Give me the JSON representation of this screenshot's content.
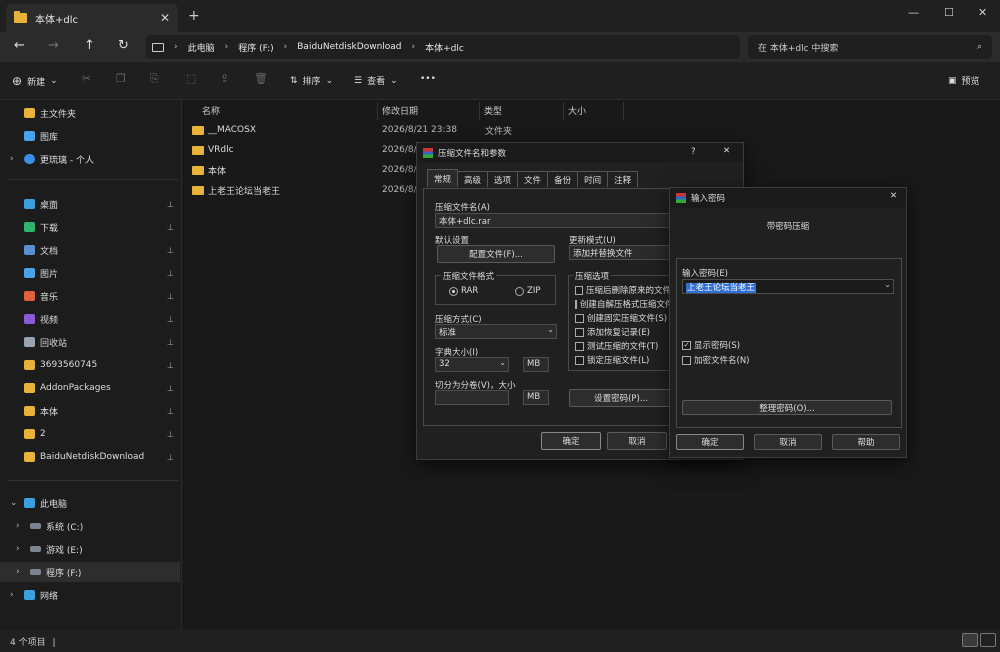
{
  "window": {
    "tab_title": "本体+dlc",
    "tab_close": "✕",
    "tab_add": "+",
    "minimize": "—",
    "maximize": "☐",
    "close": "✕"
  },
  "address": {
    "back": "←",
    "forward": "→",
    "up": "↑",
    "refresh": "↻",
    "crumbs": [
      "此电脑",
      "程序 (F:)",
      "BaiduNetdiskDownload",
      "本体+dlc"
    ],
    "crumb_sep": "›",
    "search_placeholder": "在 本体+dlc 中搜索",
    "search_icon": "⌕"
  },
  "toolbar": {
    "new_label": "新建",
    "sort_label": "排序",
    "view_label": "查看",
    "more_label": "•••",
    "preview_label": "预览",
    "icons": [
      "✂",
      "❐",
      "⎘",
      "⬚",
      "⇪",
      "🗑"
    ]
  },
  "sidebar": {
    "top": [
      {
        "label": "主文件夹",
        "color": "#e8b33b"
      },
      {
        "label": "图库",
        "color": "#4aa3e8"
      },
      {
        "label": "更琉璃 - 个人",
        "color": "#3a8ee6"
      }
    ],
    "pinned": [
      {
        "label": "桌面",
        "color": "#3aa0e0"
      },
      {
        "label": "下载",
        "color": "#2fb56e"
      },
      {
        "label": "文档",
        "color": "#5a8fd0"
      },
      {
        "label": "图片",
        "color": "#4aa3e8"
      },
      {
        "label": "音乐",
        "color": "#e06040"
      },
      {
        "label": "视频",
        "color": "#8a5ad8"
      },
      {
        "label": "回收站",
        "color": "#9aa4b0"
      },
      {
        "label": "3693560745",
        "color": "#e8b33b"
      },
      {
        "label": "AddonPackages",
        "color": "#e8b33b"
      },
      {
        "label": "本体",
        "color": "#e8b33b"
      },
      {
        "label": "2",
        "color": "#e8b33b"
      },
      {
        "label": "BaiduNetdiskDownload",
        "color": "#e8b33b"
      }
    ],
    "pin_icon": "📌",
    "pc_label": "此电脑",
    "drives": [
      {
        "label": "系统 (C:)"
      },
      {
        "label": "游戏 (E:)"
      },
      {
        "label": "程序 (F:)"
      }
    ],
    "network_label": "网络"
  },
  "files": {
    "columns": [
      "名称",
      "修改日期",
      "类型",
      "大小"
    ],
    "rows": [
      {
        "name": "__MACOSX",
        "date": "2026/8/21 23:38",
        "type": "文件夹"
      },
      {
        "name": "VRdlc",
        "date": "2026/8/2"
      },
      {
        "name": "本体",
        "date": "2026/8/2"
      },
      {
        "name": "上老王论坛当老王",
        "date": "2026/8/2"
      }
    ]
  },
  "status": {
    "count": "4 个项目",
    "bar": "|"
  },
  "archive_dialog": {
    "title": "压缩文件名和参数",
    "help": "?",
    "close": "✕",
    "tabs": [
      "常规",
      "高级",
      "选项",
      "文件",
      "备份",
      "时间",
      "注释"
    ],
    "filename_label": "压缩文件名(A)",
    "filename_value": "本体+dlc.rar",
    "default_label": "默认设置",
    "config_btn": "配置文件(F)...",
    "update_label": "更新模式(U)",
    "update_value": "添加并替换文件",
    "format_label": "压缩文件格式",
    "rar_label": "RAR",
    "zip_label": "ZIP",
    "method_label": "压缩方式(C)",
    "method_value": "标准",
    "dict_label": "字典大小(I)",
    "dict_value": "32",
    "dict_unit": "MB",
    "split_label": "切分为分卷(V)，大小",
    "split_unit": "MB",
    "options_label": "压缩选项",
    "options": [
      "压缩后删除原来的文件",
      "创建自解压格式压缩文件",
      "创建固实压缩文件(S)",
      "添加恢复记录(E)",
      "测试压缩的文件(T)",
      "锁定压缩文件(L)"
    ],
    "password_btn": "设置密码(P)...",
    "ok": "确定",
    "cancel": "取消"
  },
  "password_dialog": {
    "title": "输入密码",
    "close": "✕",
    "heading": "带密码压缩",
    "input_label": "输入密码(E)",
    "input_value": "上老王论坛当老王",
    "show_password": "显示密码(S)",
    "encrypt_names": "加密文件名(N)",
    "organize_btn": "整理密码(O)...",
    "ok": "确定",
    "cancel": "取消",
    "help": "帮助"
  }
}
